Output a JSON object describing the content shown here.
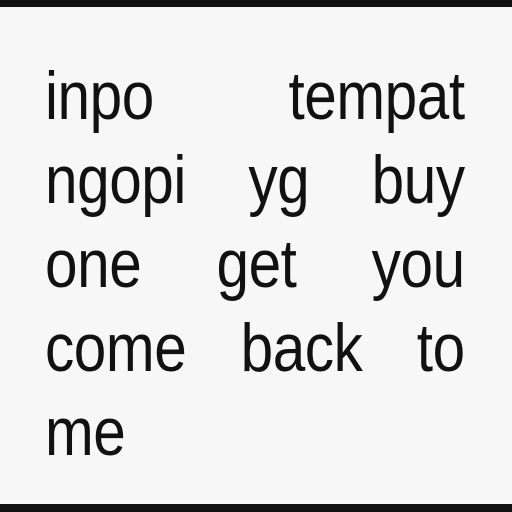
{
  "text": {
    "lines": [
      "inpo tempat",
      "ngopi yg buy",
      "one get you",
      "come back to",
      "me"
    ]
  }
}
